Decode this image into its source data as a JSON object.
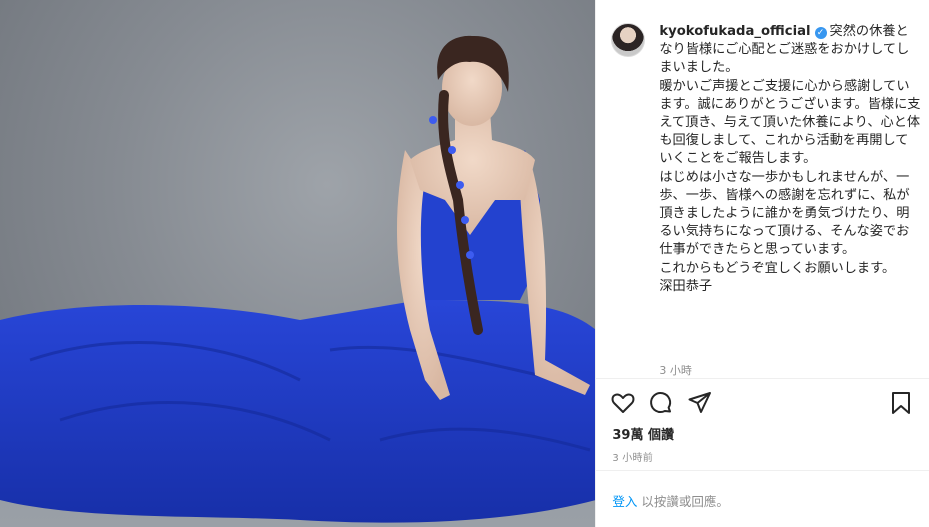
{
  "post": {
    "username": "kyokofukada_official",
    "verified_glyph": "✓",
    "caption": "突然の休養となり皆様にご心配とご迷惑をおかけしてしまいました。\n暖かいご声援とご支援に心から感謝しています。誠にありがとうございます。皆様に支えて頂き、与えて頂いた休養により、心と体も回復しまして、これから活動を再開していくことをご報告します。\nはじめは小さな一歩かもしれませんが、一歩、一歩、皆様への感謝を忘れずに、私が頂きましたように誰かを勇気づけたり、明るい気持ちになって頂ける、そんな姿でお仕事ができたらと思っています。\nこれからもどうぞ宜しくお願いします。\n深田恭子",
    "caption_time": "3 小時",
    "views": "39萬 個讚",
    "post_time": "3 小時前"
  },
  "footer": {
    "login_link": "登入",
    "login_text": " 以按讚或回應。"
  },
  "icons": {
    "like": "heart-icon",
    "comment": "comment-icon",
    "share": "paper-plane-icon",
    "save": "bookmark-icon",
    "verified": "verified-badge-icon"
  },
  "colors": {
    "link": "#0095f6",
    "verified": "#3897f0",
    "dress": "#1f3fd0",
    "muted_text": "#8e8e8e"
  }
}
